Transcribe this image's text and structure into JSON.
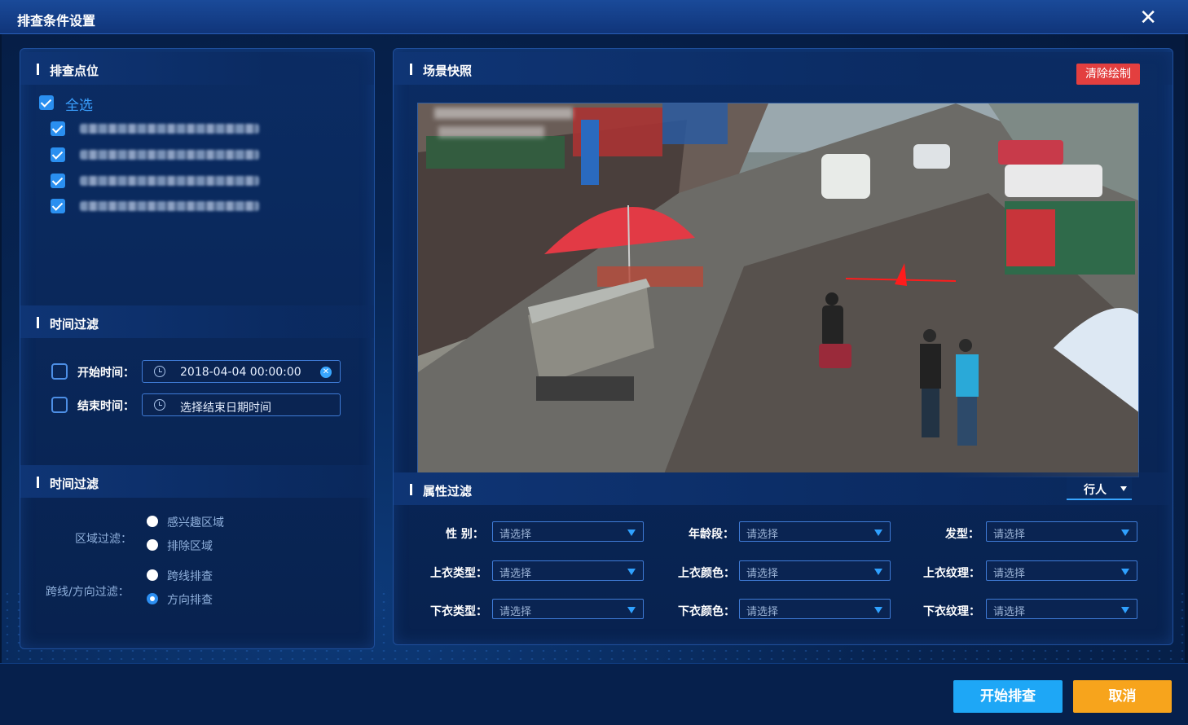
{
  "window": {
    "title": "排查条件设置"
  },
  "points": {
    "header": "排查点位",
    "select_all": "全选",
    "items_count_visible": 4
  },
  "time_filter": {
    "header": "时间过滤",
    "start_label": "开始时间：",
    "start_value": "2018-04-04  00:00:00",
    "end_label": "结束时间：",
    "end_placeholder": "选择结束日期时间"
  },
  "region_filter": {
    "header": "时间过滤",
    "region_label": "区域过滤：",
    "region_options": [
      "感兴趣区域",
      "排除区域"
    ],
    "cross_label": "跨线/方向过滤：",
    "cross_options": [
      "跨线排查",
      "方向排查"
    ],
    "cross_selected": "方向排查"
  },
  "snapshot": {
    "header": "场景快照",
    "clear_label": "清除绘制"
  },
  "attributes": {
    "header": "属性过滤",
    "type_value": "行人",
    "placeholder": "请选择",
    "fields": [
      [
        "性  别：",
        "年龄段：",
        "发型："
      ],
      [
        "上衣类型：",
        "上衣颜色：",
        "上衣纹理："
      ],
      [
        "下衣类型：",
        "下衣颜色：",
        "下衣纹理："
      ]
    ]
  },
  "footer": {
    "start_label": "开始排查",
    "cancel_label": "取消"
  },
  "colors": {
    "accent": "#1ea7f6",
    "cancel": "#f7a41c",
    "clear": "#e33f3f",
    "arrow": "#ff1c1c"
  }
}
